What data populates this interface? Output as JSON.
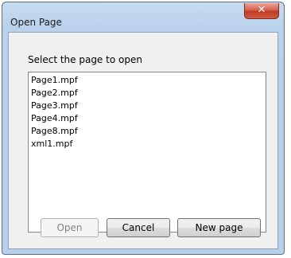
{
  "window": {
    "title": "Open Page",
    "close_icon": "close-icon"
  },
  "dialog": {
    "prompt": "Select the page to open",
    "files": [
      "Page1.mpf",
      "Page2.mpf",
      "Page3.mpf",
      "Page4.mpf",
      "Page8.mpf",
      "xml1.mpf"
    ]
  },
  "buttons": {
    "open_label": "Open",
    "open_enabled": false,
    "cancel_label": "Cancel",
    "new_page_label": "New page"
  }
}
